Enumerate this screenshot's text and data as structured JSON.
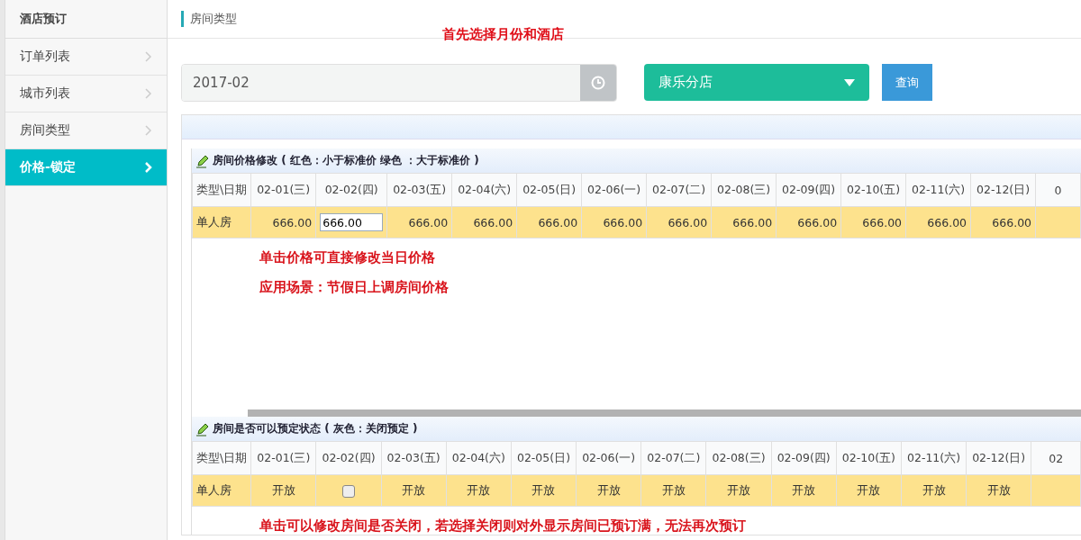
{
  "sidebar": {
    "title": "酒店预订",
    "items": [
      {
        "label": "订单列表",
        "selected": false
      },
      {
        "label": "城市列表",
        "selected": false
      },
      {
        "label": "房间类型",
        "selected": false
      },
      {
        "label": "价格-锁定",
        "selected": true
      }
    ]
  },
  "breadcrumb": "房间类型",
  "hint": "首先选择月份和酒店",
  "filters": {
    "month": "2017-02",
    "hotel": "康乐分店",
    "query_button": "查询"
  },
  "sections": [
    {
      "title": "房间价格修改 ( 红色：小于标准价 绿色 ：大于标准价 )",
      "kind": "price",
      "columns": [
        "类型\\日期",
        "02-01(三)",
        "02-02(四)",
        "02-03(五)",
        "02-04(六)",
        "02-05(日)",
        "02-06(一)",
        "02-07(二)",
        "02-08(三)",
        "02-09(四)",
        "02-10(五)",
        "02-11(六)",
        "02-12(日)",
        "0"
      ],
      "rows": [
        {
          "cells": [
            {
              "kind": "label",
              "text": "单人房"
            },
            {
              "kind": "text",
              "text": "666.00"
            },
            {
              "kind": "input",
              "value": "666.00"
            },
            {
              "kind": "text",
              "text": "666.00"
            },
            {
              "kind": "text",
              "text": "666.00"
            },
            {
              "kind": "text",
              "text": "666.00"
            },
            {
              "kind": "text",
              "text": "666.00"
            },
            {
              "kind": "text",
              "text": "666.00"
            },
            {
              "kind": "text",
              "text": "666.00"
            },
            {
              "kind": "text",
              "text": "666.00"
            },
            {
              "kind": "text",
              "text": "666.00"
            },
            {
              "kind": "text",
              "text": "666.00"
            },
            {
              "kind": "text",
              "text": "666.00"
            }
          ]
        }
      ],
      "notes": [
        "单击价格可直接修改当日价格",
        "应用场景：节假日上调房间价格"
      ]
    },
    {
      "title": "房间是否可以预定状态 ( 灰色：关闭预定 )",
      "kind": "status",
      "columns": [
        "类型\\日期",
        "02-01(三)",
        "02-02(四)",
        "02-03(五)",
        "02-04(六)",
        "02-05(日)",
        "02-06(一)",
        "02-07(二)",
        "02-08(三)",
        "02-09(四)",
        "02-10(五)",
        "02-11(六)",
        "02-12(日)",
        "02"
      ],
      "rows": [
        {
          "cells": [
            {
              "kind": "label",
              "text": "单人房"
            },
            {
              "kind": "text",
              "text": "开放"
            },
            {
              "kind": "checkbox",
              "checked": false
            },
            {
              "kind": "text",
              "text": "开放"
            },
            {
              "kind": "text",
              "text": "开放"
            },
            {
              "kind": "text",
              "text": "开放"
            },
            {
              "kind": "text",
              "text": "开放"
            },
            {
              "kind": "text",
              "text": "开放"
            },
            {
              "kind": "text",
              "text": "开放"
            },
            {
              "kind": "text",
              "text": "开放"
            },
            {
              "kind": "text",
              "text": "开放"
            },
            {
              "kind": "text",
              "text": "开放"
            },
            {
              "kind": "text",
              "text": "开放"
            }
          ]
        }
      ],
      "notes": [
        "单击可以修改房间是否关闭，若选择关闭则对外显示房间已预订满，无法再次预订"
      ]
    }
  ]
}
